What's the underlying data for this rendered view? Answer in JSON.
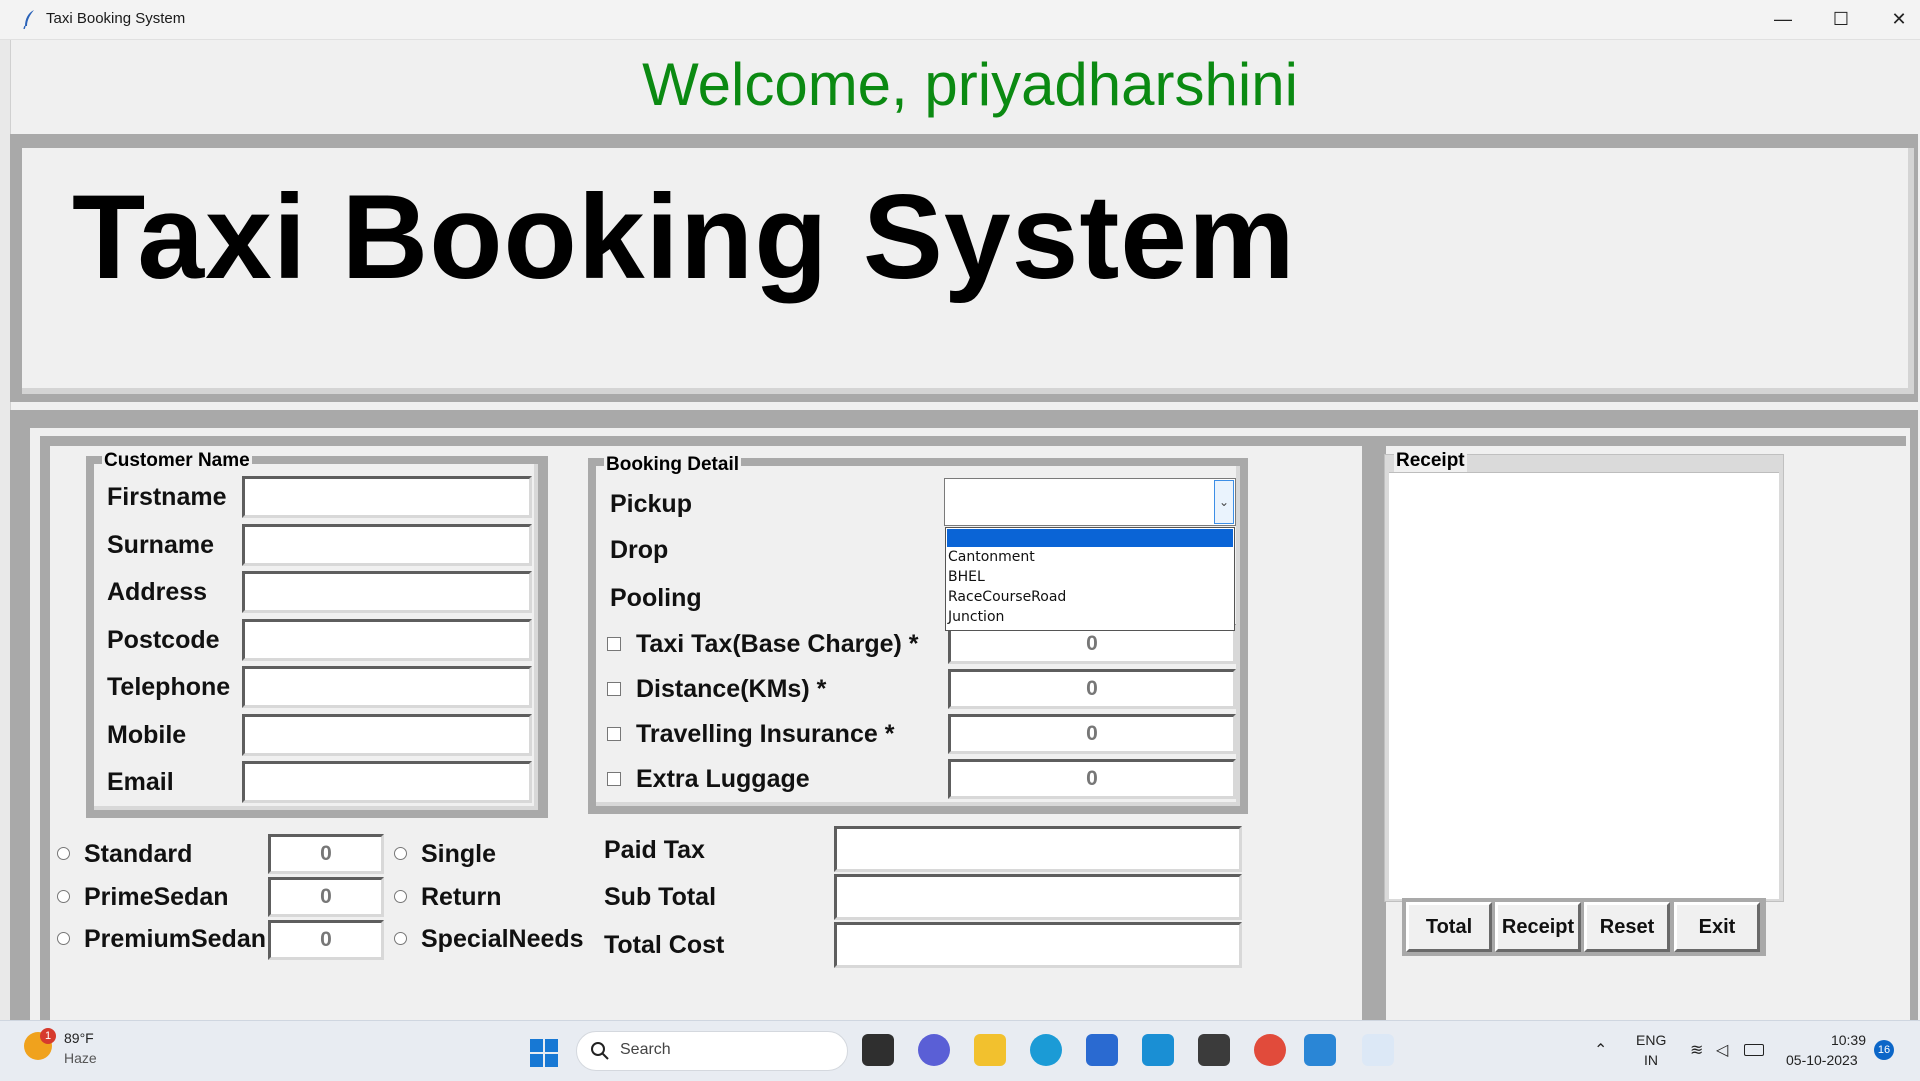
{
  "window": {
    "title": "Taxi Booking System"
  },
  "welcome": "Welcome, priyadharshini",
  "heading": "Taxi Booking System",
  "customer": {
    "legend": "Customer Name",
    "fields": [
      {
        "label": "Firstname",
        "value": ""
      },
      {
        "label": "Surname",
        "value": ""
      },
      {
        "label": "Address",
        "value": ""
      },
      {
        "label": "Postcode",
        "value": ""
      },
      {
        "label": "Telephone",
        "value": ""
      },
      {
        "label": "Mobile",
        "value": ""
      },
      {
        "label": "Email",
        "value": ""
      }
    ]
  },
  "booking": {
    "legend": "Booking Detail",
    "pickup_label": "Pickup",
    "drop_label": "Drop",
    "pooling_label": "Pooling",
    "pickup_value": "",
    "dropdown_options": [
      "",
      "Cantonment",
      "BHEL",
      "RaceCourseRoad",
      "Junction"
    ],
    "charges": [
      {
        "label": "Taxi Tax(Base Charge) *",
        "value": "0"
      },
      {
        "label": "Distance(KMs) *",
        "value": "0"
      },
      {
        "label": "Travelling Insurance *",
        "value": "0"
      },
      {
        "label": "Extra Luggage",
        "value": "0"
      }
    ]
  },
  "car_types": [
    {
      "label": "Standard",
      "value": "0"
    },
    {
      "label": "PrimeSedan",
      "value": "0"
    },
    {
      "label": "PremiumSedan",
      "value": "0"
    }
  ],
  "journey": [
    "Single",
    "Return",
    "SpecialNeeds"
  ],
  "costs": [
    {
      "label": "Paid Tax",
      "value": ""
    },
    {
      "label": "Sub Total",
      "value": ""
    },
    {
      "label": "Total Cost",
      "value": ""
    }
  ],
  "receipt": {
    "legend": "Receipt",
    "content": ""
  },
  "buttons": [
    "Total",
    "Receipt",
    "Reset",
    "Exit"
  ],
  "taskbar": {
    "weather_temp": "89°F",
    "weather_desc": "Haze",
    "weather_badge": "1",
    "search_label": "Search",
    "lang": "ENG",
    "region": "IN",
    "time": "10:39",
    "date": "05-10-2023",
    "notifications": "16"
  },
  "colors": {
    "welcome": "#0b8a12",
    "selection": "#0a64d6"
  }
}
